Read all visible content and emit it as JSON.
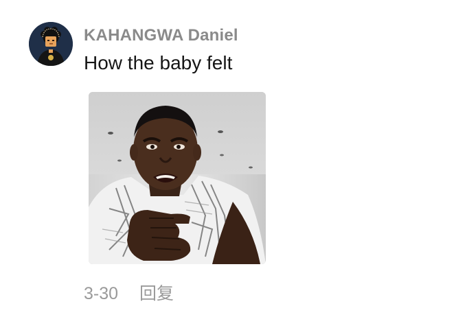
{
  "comment": {
    "author": "KAHANGWA Daniel",
    "text": "How the baby felt",
    "date": "3-30",
    "reply_label": "回复",
    "avatar_icon": "user-avatar",
    "attachment": "meme-image"
  },
  "colors": {
    "author": "#8a8a8a",
    "text": "#161616",
    "meta": "#9a9a9a",
    "background": "#ffffff"
  }
}
